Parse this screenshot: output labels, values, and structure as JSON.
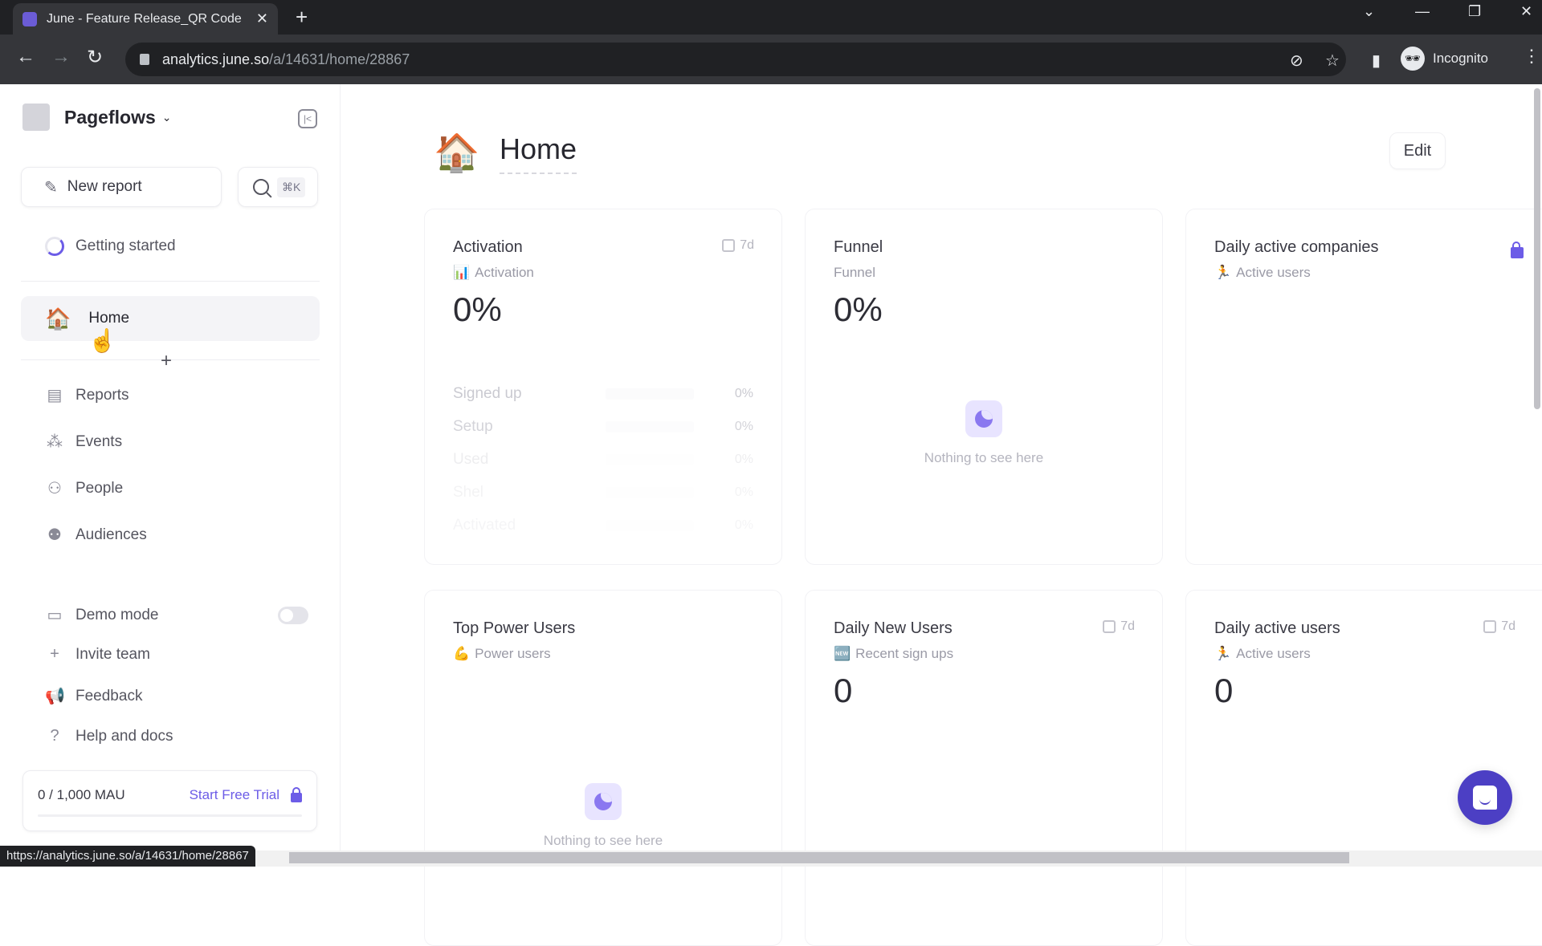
{
  "browser": {
    "tab_title": "June - Feature Release_QR Code",
    "url_host": "analytics.june.so",
    "url_path": "/a/14631/home/28867",
    "profile_label": "Incognito",
    "status_url": "https://analytics.june.so/a/14631/home/28867"
  },
  "sidebar": {
    "workspace_name": "Pageflows",
    "new_report_label": "New report",
    "search_shortcut": "⌘K",
    "getting_started_label": "Getting started",
    "home_label": "Home",
    "nav_items": [
      {
        "label": "Reports",
        "icon": "reports-icon"
      },
      {
        "label": "Events",
        "icon": "events-icon"
      },
      {
        "label": "People",
        "icon": "people-icon"
      },
      {
        "label": "Audiences",
        "icon": "audiences-icon"
      }
    ],
    "demo_mode_label": "Demo mode",
    "demo_mode_on": false,
    "invite_label": "Invite team",
    "feedback_label": "Feedback",
    "help_label": "Help and docs",
    "mau_count": "0 / 1,000 MAU",
    "trial_label": "Start Free Trial",
    "mau_progress": 0
  },
  "main": {
    "page_title": "Home",
    "edit_label": "Edit",
    "accent_color": "#6c5ce7",
    "cards": [
      {
        "title": "Activation",
        "subtitle": "Activation",
        "subtitle_emoji": "📊",
        "value": "0%",
        "period": "7d",
        "funnel": [
          {
            "label": "Signed up",
            "pct": "0%"
          },
          {
            "label": "Setup",
            "pct": "0%"
          },
          {
            "label": "Used",
            "pct": "0%"
          },
          {
            "label": "Shel",
            "pct": "0%"
          },
          {
            "label": "Activated",
            "pct": "0%"
          }
        ]
      },
      {
        "title": "Funnel",
        "subtitle": "Funnel",
        "value": "0%",
        "empty_text": "Nothing to see here"
      },
      {
        "title": "Daily active companies",
        "subtitle": "Active users",
        "subtitle_emoji": "🏃",
        "locked": true
      },
      {
        "title": "Top Power Users",
        "subtitle": "Power users",
        "subtitle_emoji": "💪",
        "empty_text": "Nothing to see here"
      },
      {
        "title": "Daily New Users",
        "subtitle": "Recent sign ups",
        "subtitle_emoji": "🆕",
        "value": "0",
        "period": "7d"
      },
      {
        "title": "Daily active users",
        "subtitle": "Active users",
        "subtitle_emoji": "🏃",
        "value": "0",
        "period": "7d"
      }
    ]
  }
}
